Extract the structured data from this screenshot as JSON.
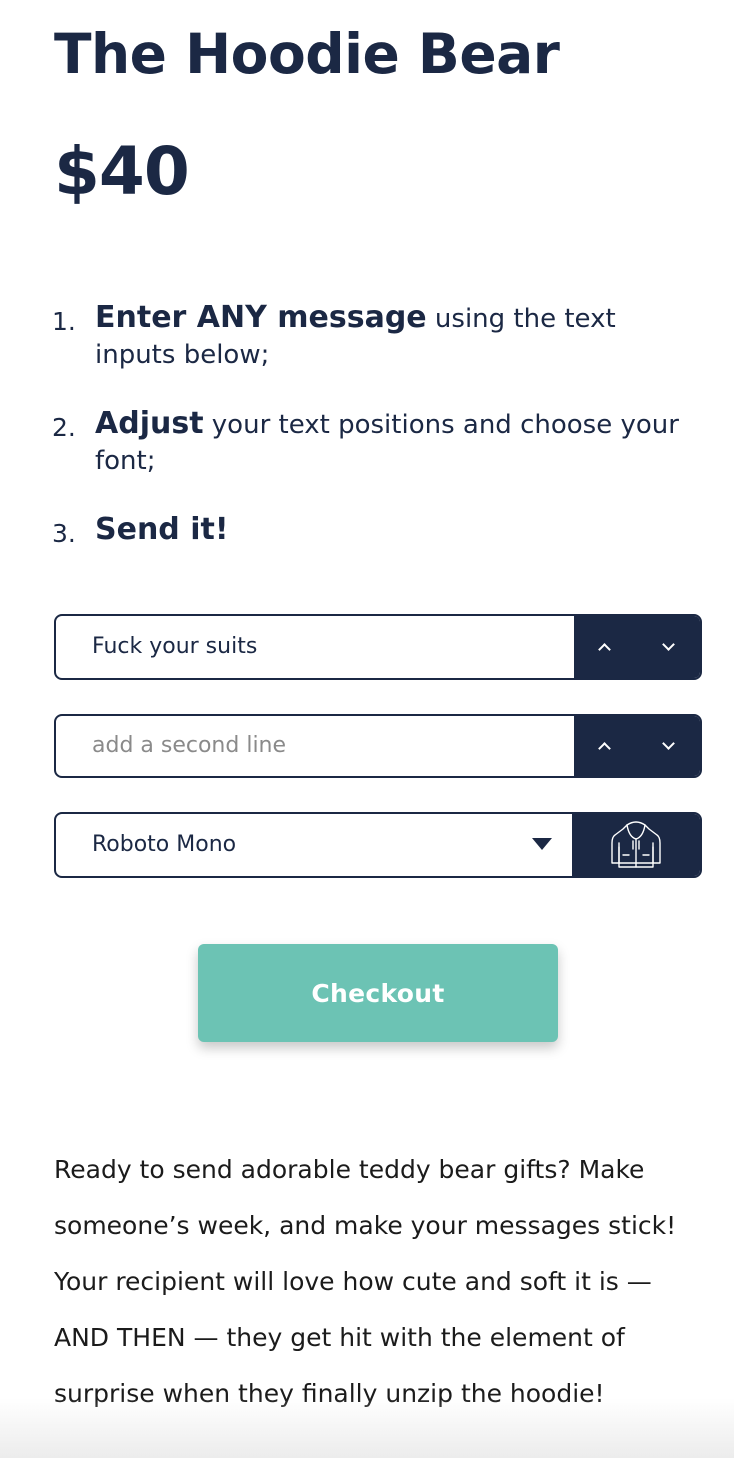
{
  "product": {
    "title": "The Hoodie Bear",
    "price": "$40"
  },
  "instructions": [
    {
      "number": "1.",
      "bold": "Enter ANY message",
      "rest": " using the text inputs below;"
    },
    {
      "number": "2.",
      "bold": "Adjust",
      "rest": " your text positions and choose your font;"
    },
    {
      "number": "3.",
      "bold": "Send it!",
      "rest": ""
    }
  ],
  "form": {
    "line1": {
      "value": "Fuck your suits",
      "placeholder": ""
    },
    "line2": {
      "value": "",
      "placeholder": "add a second line"
    },
    "font_select": {
      "selected": "Roboto Mono"
    },
    "stepper_icons": {
      "up": "chevron-up-icon",
      "down": "chevron-down-icon"
    },
    "preview_icon": "hoodie-icon"
  },
  "checkout": {
    "label": "Checkout"
  },
  "description": "Ready to send adorable teddy bear gifts? Make someone’s week, and make your messages stick! Your recipient will love how cute and soft it is — AND THEN — they get hit with the element of surprise when they finally unzip the hoodie!",
  "colors": {
    "navy": "#1b2844",
    "teal_button": "#6cc3b4",
    "placeholder_gray": "#8a8a8a"
  }
}
